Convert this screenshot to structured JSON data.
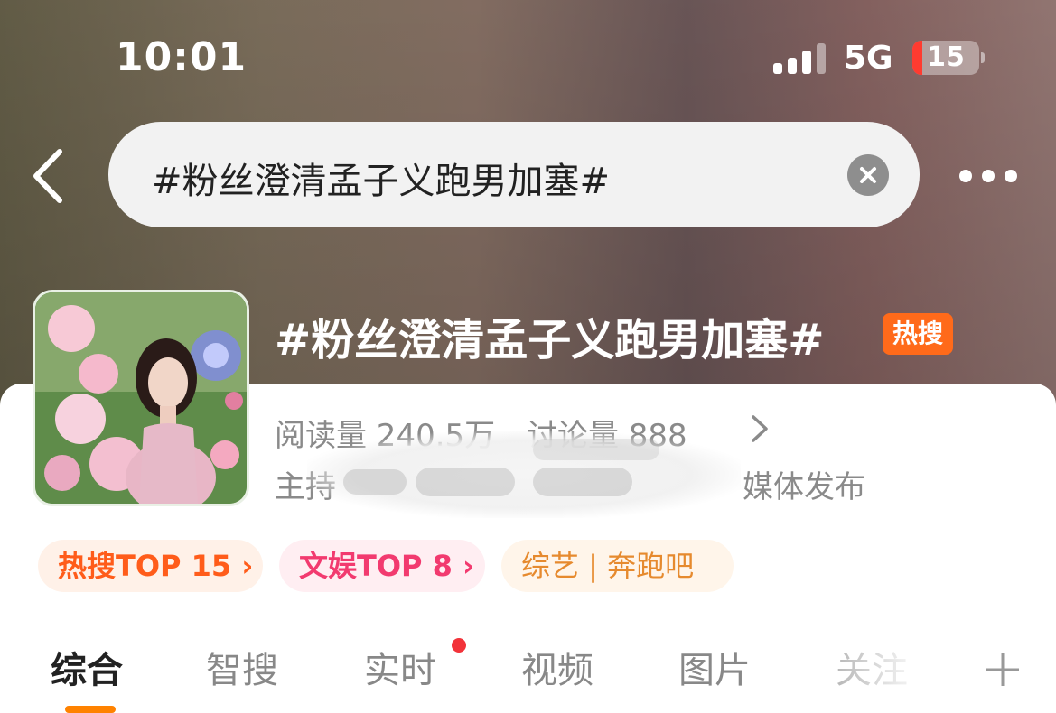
{
  "status_bar": {
    "time": "10:01",
    "network": "5G",
    "battery_level": "15",
    "battery_fraction": 0.15,
    "icons": [
      "signal-bars-icon",
      "battery-icon"
    ]
  },
  "nav": {
    "back_icon": "chevron-left-icon",
    "search_query": "#粉丝澄清孟子义跑男加塞#",
    "clear_icon": "clear-circle-icon",
    "more_icon": "more-dots-icon"
  },
  "topic": {
    "title": "#粉丝澄清孟子义跑男加塞#",
    "badge": "热搜",
    "stats": {
      "reads": "阅读量 240.5万",
      "discussions": "讨论量 888"
    },
    "host_prefix": "主持",
    "host_suffix": "媒体发布"
  },
  "chips": [
    {
      "label": "热搜TOP 15 ›"
    },
    {
      "label": "文娱TOP 8 ›"
    },
    {
      "label": "综艺 | 奔跑吧"
    }
  ],
  "tabs": [
    "综合",
    "智搜",
    "实时",
    "视频",
    "图片",
    "关注"
  ],
  "active_tab": "综合",
  "colors": {
    "accent": "#ff8200",
    "hot_badge": "#ff6a1a",
    "live_dot": "#f2333a",
    "chip_hot_text": "#ff5c1a",
    "chip_ent_text": "#f23a6f",
    "chip_show_text": "#e68a2e"
  }
}
